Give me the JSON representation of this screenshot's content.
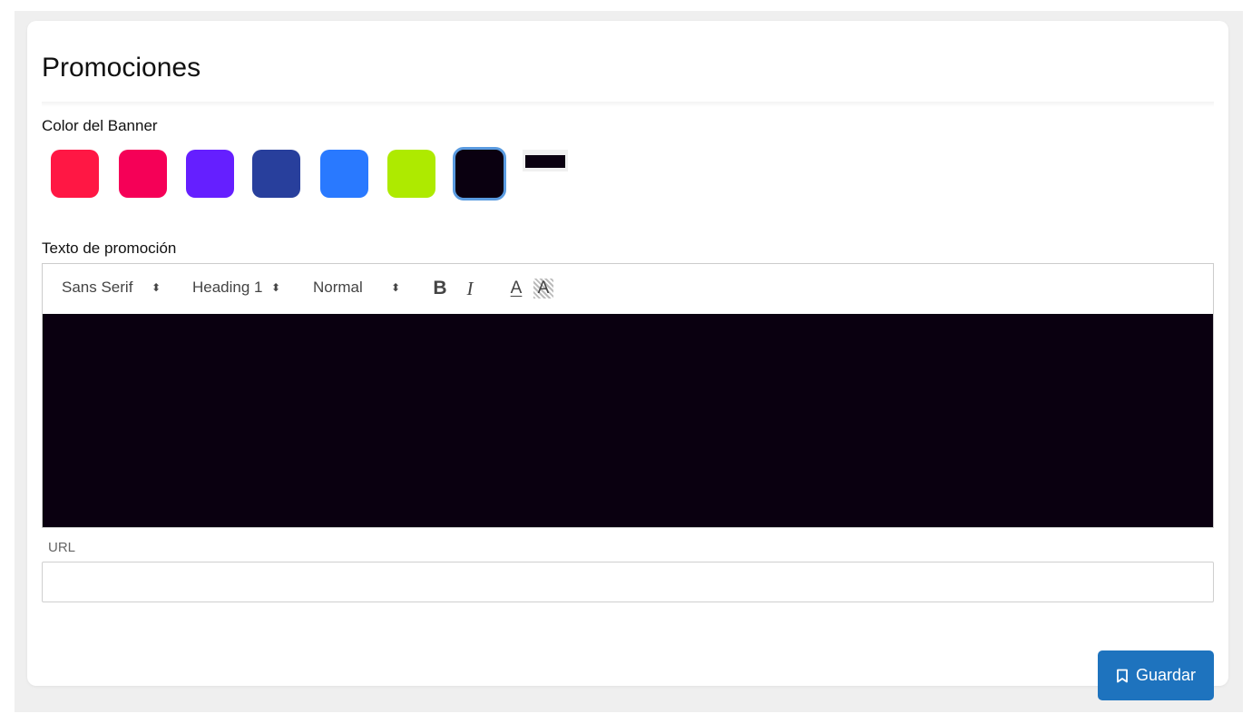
{
  "page": {
    "title": "Promociones"
  },
  "banner_color": {
    "label": "Color del Banner",
    "swatches": [
      "#ff1744",
      "#f50057",
      "#651fff",
      "#283f9c",
      "#2979ff",
      "#aeea00",
      "#0a0010"
    ],
    "selected_index": 6,
    "custom_color": "#0a0010"
  },
  "promo_text": {
    "label": "Texto de promoción",
    "toolbar": {
      "font_select": "Sans Serif",
      "header_select": "Heading 1",
      "size_select": "Normal",
      "bold_label": "B",
      "italic_label": "I",
      "color_label": "A",
      "background_label": "A"
    },
    "editor_background": "#0a0010"
  },
  "url": {
    "label": "URL",
    "value": "",
    "placeholder": ""
  },
  "save": {
    "label": "Guardar",
    "color": "#1e73be",
    "icon": "bookmark-icon"
  }
}
